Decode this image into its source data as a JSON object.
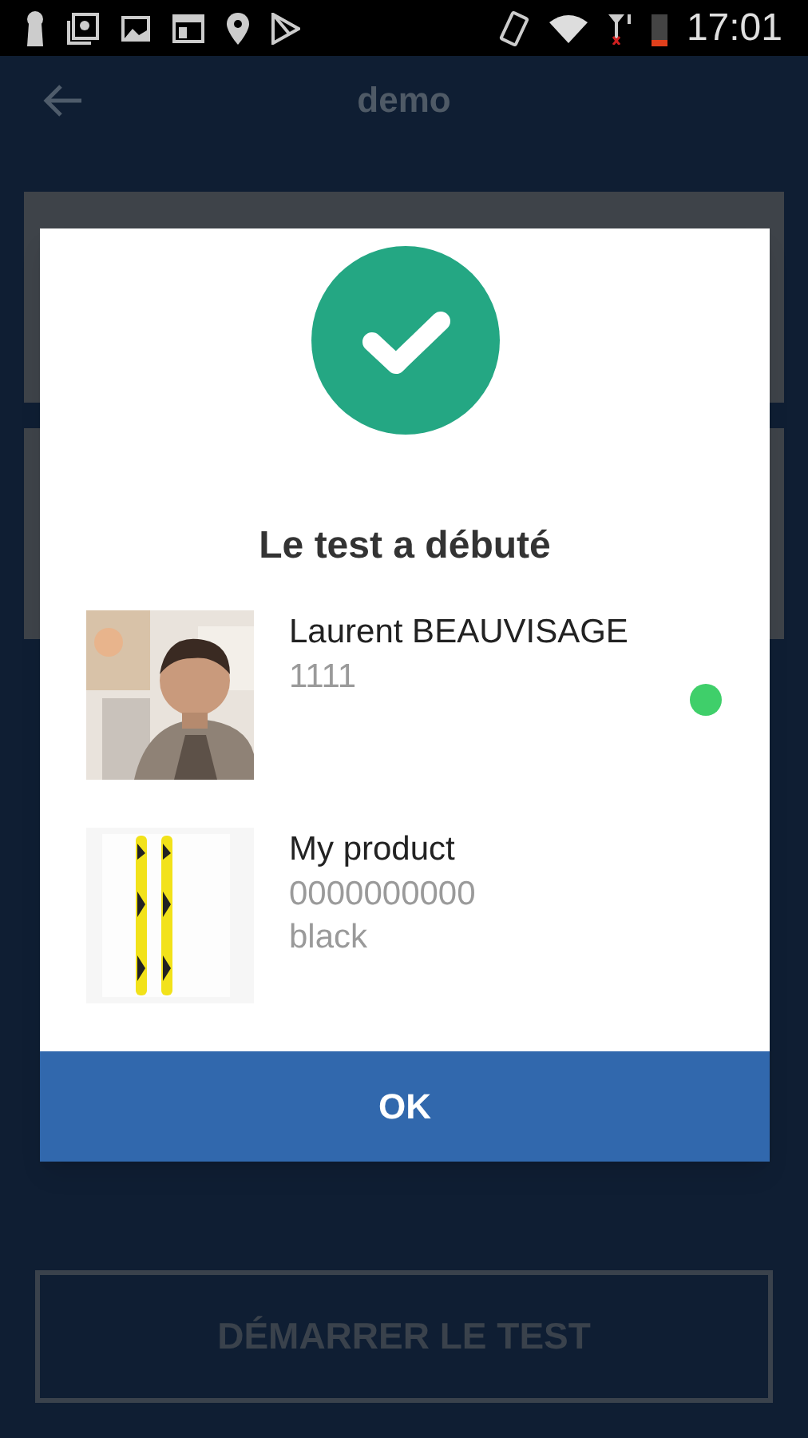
{
  "status_bar": {
    "time": "17:01"
  },
  "app_bar": {
    "title": "demo"
  },
  "dialog": {
    "title": "Le test a débuté",
    "items": [
      {
        "kind": "person",
        "name": "Laurent BEAUVISAGE",
        "lines": [
          "1111"
        ],
        "color": "#3fcf6a"
      },
      {
        "kind": "product",
        "name": "My product",
        "lines": [
          "0000000000",
          "black"
        ]
      }
    ],
    "ok_button": "OK"
  },
  "start_button": {
    "label": "DÉMARRER LE TEST",
    "disabled": true
  }
}
